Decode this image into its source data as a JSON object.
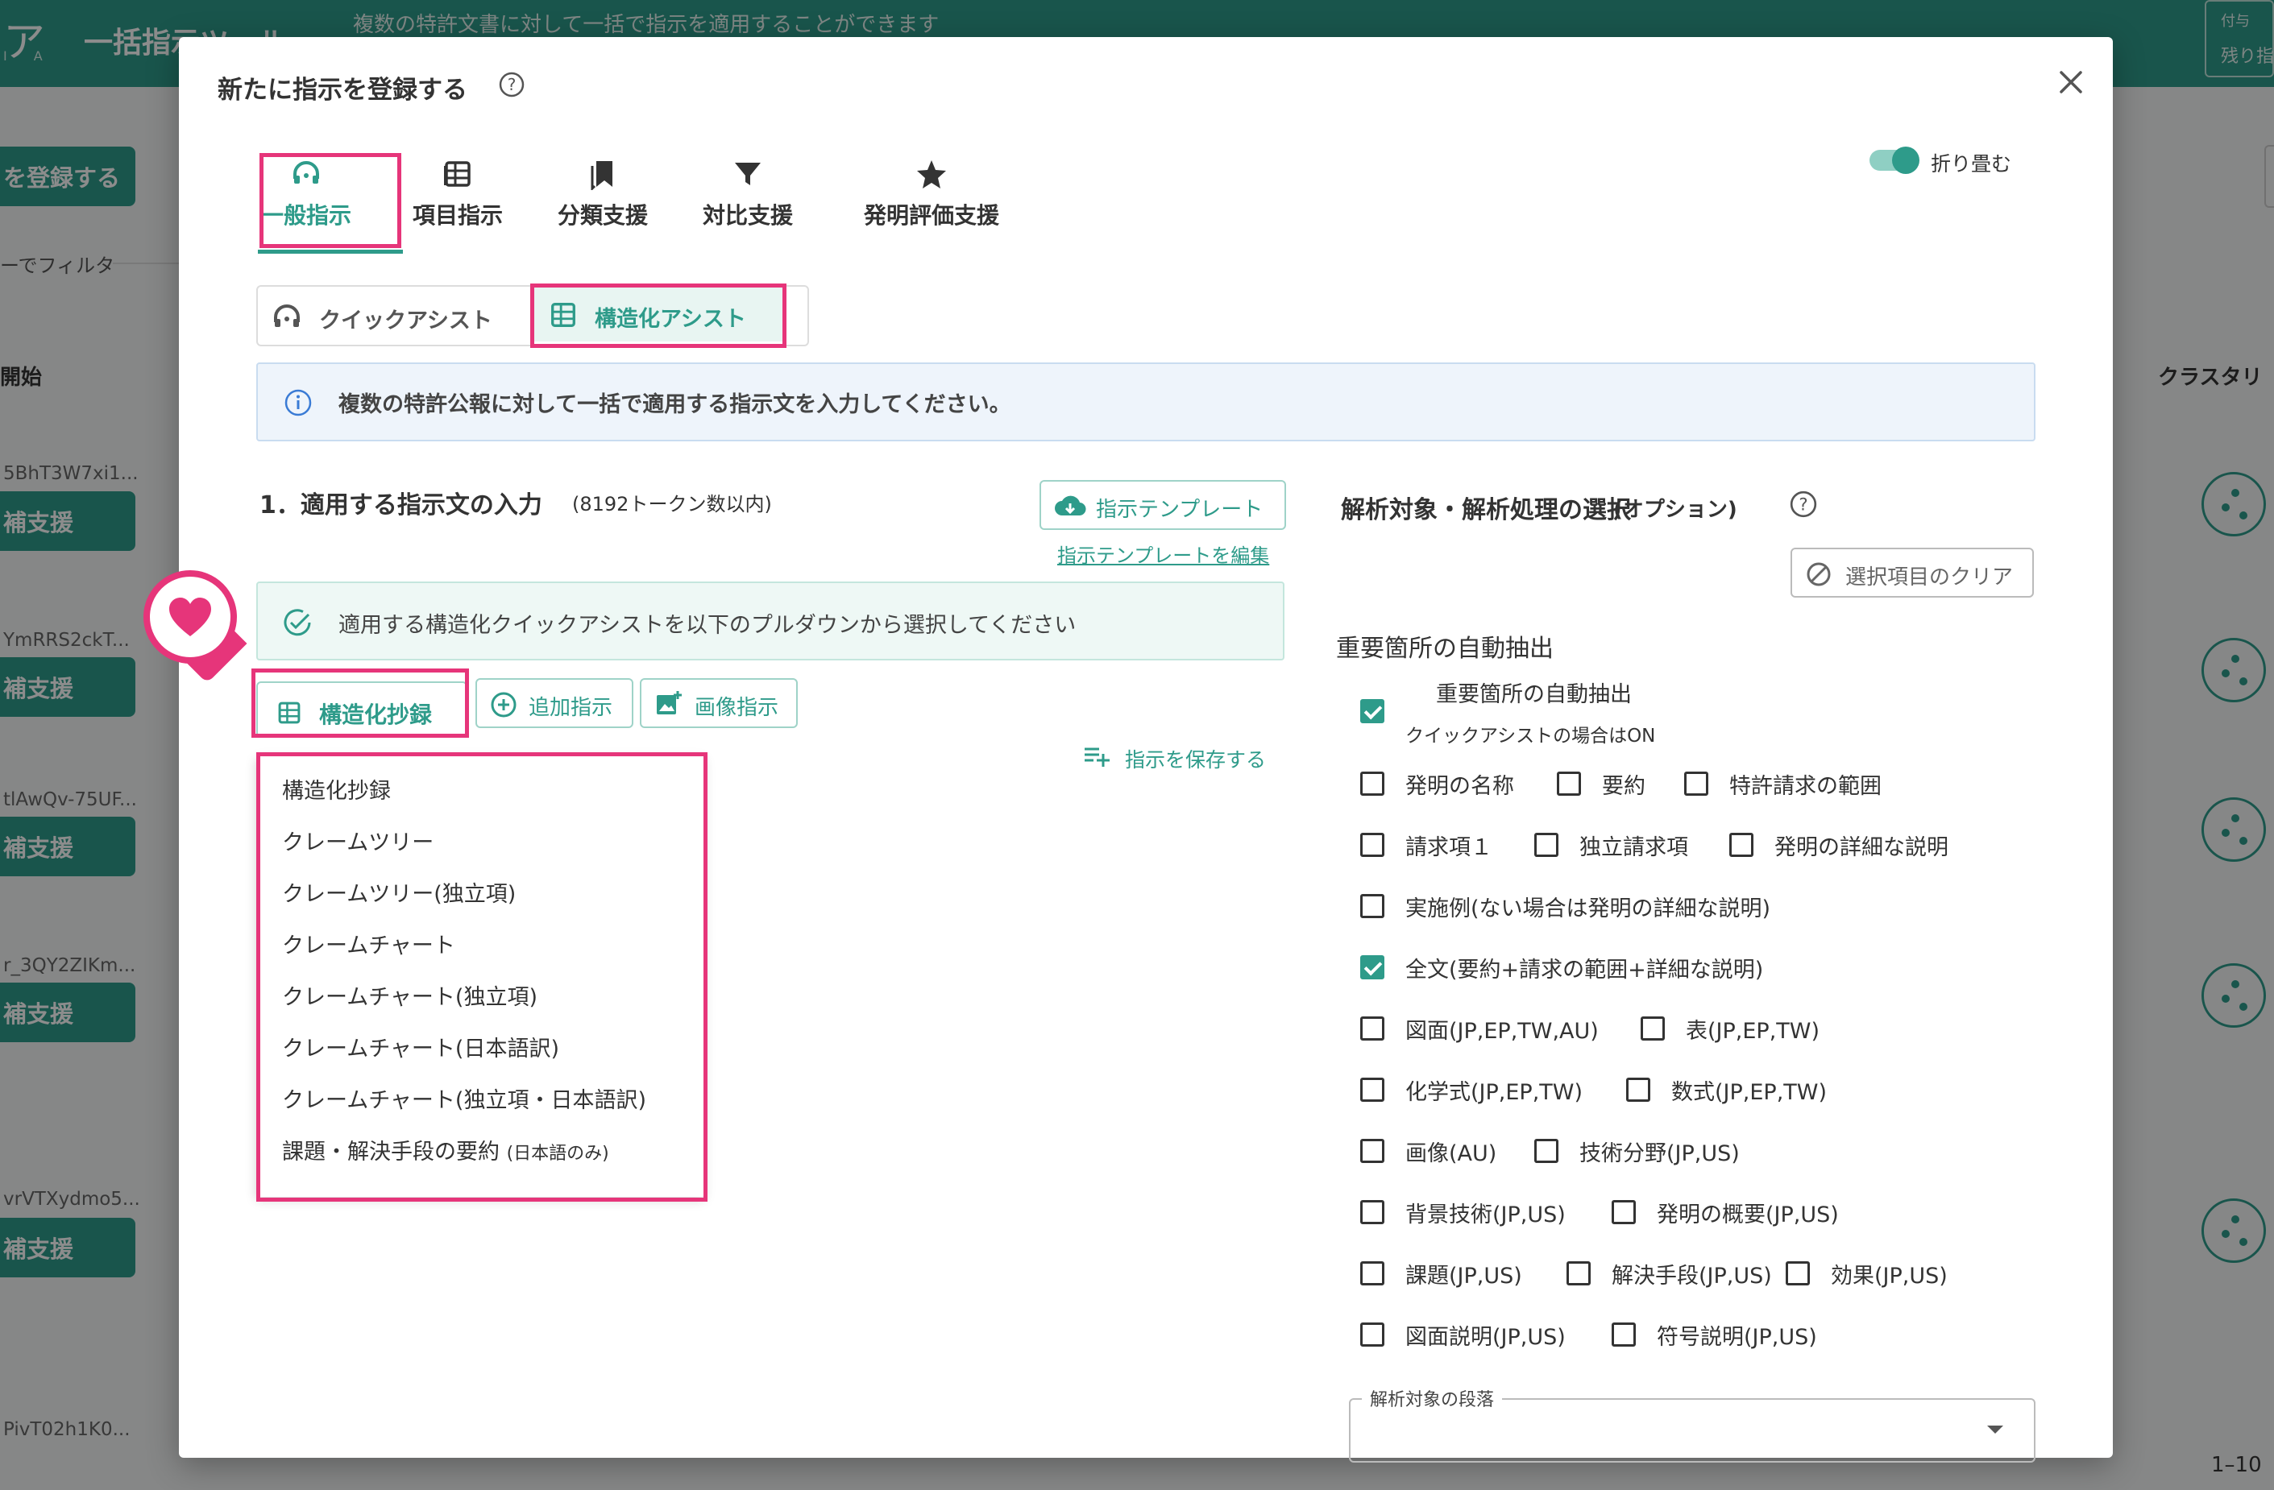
{
  "background": {
    "header_title": "一括指示ツール",
    "header_subtitle": "複数の特許文書に対して一括で指示を適用することができます",
    "logo_text": "ア",
    "logo_sub": "I A",
    "header_right_1": "付与",
    "header_right_2": "残り指",
    "register_button": "を登録する",
    "filter_label": "ーでフィルタ",
    "col_start": "開始",
    "col_cluster": "クラスタリ",
    "pagination": "1–10",
    "rows": [
      {
        "id": "5BhT3W7xi1...",
        "button": "補支援"
      },
      {
        "id": "YmRRS2ckT...",
        "button": "補支援"
      },
      {
        "id": "tlAwQv-75UF...",
        "button": "補支援"
      },
      {
        "id": "r_3QY2ZIKm...",
        "button": "補支援"
      },
      {
        "id": "vrVTXydmo5...",
        "button": "補支援"
      },
      {
        "id": "PivT02h1K0...",
        "button": ""
      }
    ]
  },
  "modal": {
    "title": "新たに指示を登録する",
    "collapse_label": "折り畳む",
    "tabs": [
      {
        "label": "一般指示",
        "icon": "headset-icon"
      },
      {
        "label": "項目指示",
        "icon": "table-icon"
      },
      {
        "label": "分類支援",
        "icon": "bookmarks-icon"
      },
      {
        "label": "対比支援",
        "icon": "filter-icon"
      },
      {
        "label": "発明評価支援",
        "icon": "star-icon"
      }
    ],
    "subtabs": {
      "quick": "クイックアシスト",
      "structured": "構造化アシスト"
    },
    "info_text": "複数の特許公報に対して一括で適用する指示文を入力してください。",
    "section1": {
      "title": "1．適用する指示文の入力",
      "token_note": "(8192トークン数以内)",
      "template_button": "指示テンプレート",
      "edit_template_link": "指示テンプレートを編集",
      "assist_hint": "適用する構造化クイックアシストを以下のプルダウンから選択してください",
      "struct_button": "構造化抄録",
      "add_button": "追加指示",
      "image_button": "画像指示",
      "save_link": "指示を保存する",
      "dropdown": [
        "構造化抄録",
        "クレームツリー",
        "クレームツリー(独立項)",
        "クレームチャート",
        "クレームチャート(独立項)",
        "クレームチャート(日本語訳)",
        "クレームチャート(独立項・日本語訳)",
        "課題・解決手段の要約"
      ],
      "dropdown_last_note": "(日本語のみ)"
    },
    "section2": {
      "title": "解析対象・解析処理の選択",
      "title_note": "(オプション)",
      "clear_button": "選択項目のクリア",
      "auto_extract_heading": "重要箇所の自動抽出",
      "auto_extract_label": "重要箇所の自動抽出",
      "auto_extract_note": "クイックアシストの場合はON",
      "auto_extract_checked": true,
      "checkboxes": [
        {
          "label": "発明の名称",
          "checked": false
        },
        {
          "label": "要約",
          "checked": false
        },
        {
          "label": "特許請求の範囲",
          "checked": false
        },
        {
          "label": "請求項１",
          "checked": false
        },
        {
          "label": "独立請求項",
          "checked": false
        },
        {
          "label": "発明の詳細な説明",
          "checked": false
        },
        {
          "label": "実施例(ない場合は発明の詳細な説明)",
          "checked": false
        },
        {
          "label": "全文(要約+請求の範囲+詳細な説明)",
          "checked": true
        },
        {
          "label": "図面(JP,EP,TW,AU)",
          "checked": false
        },
        {
          "label": "表(JP,EP,TW)",
          "checked": false
        },
        {
          "label": "化学式(JP,EP,TW)",
          "checked": false
        },
        {
          "label": "数式(JP,EP,TW)",
          "checked": false
        },
        {
          "label": "画像(AU)",
          "checked": false
        },
        {
          "label": "技術分野(JP,US)",
          "checked": false
        },
        {
          "label": "背景技術(JP,US)",
          "checked": false
        },
        {
          "label": "発明の概要(JP,US)",
          "checked": false
        },
        {
          "label": "課題(JP,US)",
          "checked": false
        },
        {
          "label": "解決手段(JP,US)",
          "checked": false
        },
        {
          "label": "効果(JP,US)",
          "checked": false
        },
        {
          "label": "図面説明(JP,US)",
          "checked": false
        },
        {
          "label": "符号説明(JP,US)",
          "checked": false
        }
      ],
      "paragraph_select_label": "解析対象の段落",
      "paragraph_select_value": ""
    }
  },
  "colors": {
    "accent": "#2e9b8a",
    "highlight": "#e6357a",
    "info_bg": "#eef4fb"
  }
}
